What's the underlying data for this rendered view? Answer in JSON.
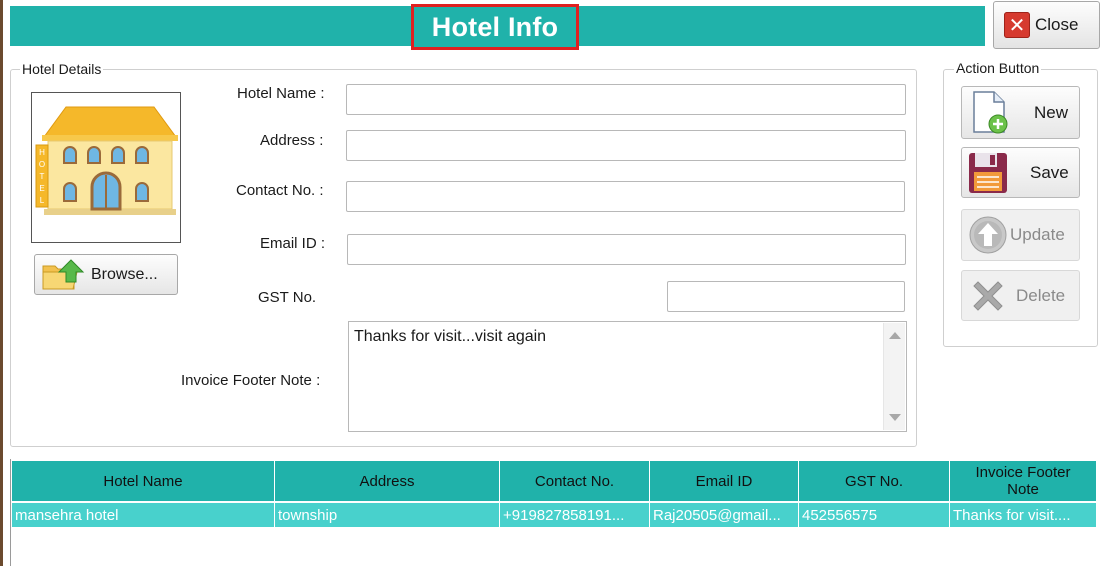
{
  "window": {
    "title": "Hotel Info",
    "close_label": "Close"
  },
  "hotel_details": {
    "legend": "Hotel Details",
    "browse_label": "Browse...",
    "labels": {
      "hotel_name": "Hotel Name :",
      "address": "Address :",
      "contact_no": "Contact No. :",
      "email_id": "Email ID :",
      "gst_no": "GST No.",
      "invoice_footer_note": "Invoice Footer Note :"
    },
    "values": {
      "hotel_name": "",
      "address": "",
      "contact_no": "",
      "email_id": "",
      "gst_no": "",
      "invoice_footer_note": "Thanks for visit...visit again"
    }
  },
  "actions": {
    "legend": "Action Button",
    "new_label": "New",
    "save_label": "Save",
    "update_label": "Update",
    "delete_label": "Delete"
  },
  "grid": {
    "columns": [
      "Hotel Name",
      "Address",
      "Contact No.",
      "Email ID",
      "GST No.",
      "Invoice Footer Note"
    ],
    "rows": [
      {
        "hotel_name": "mansehra hotel",
        "address": "township",
        "contact_no": "+919827858191...",
        "email_id": "Raj20505@gmail...",
        "gst_no": "452556575",
        "invoice_footer_note": "Thanks for visit...."
      }
    ]
  },
  "colors": {
    "header_teal": "#20b2aa",
    "selected_row": "#48d1cc",
    "title_border": "#e02020"
  }
}
